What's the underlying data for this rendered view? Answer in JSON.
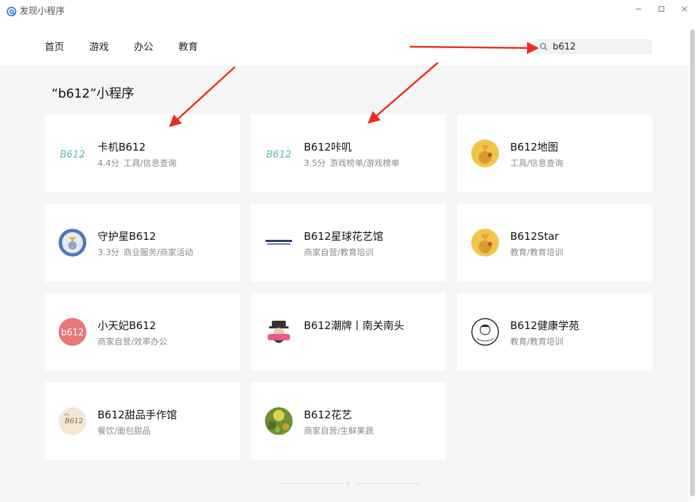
{
  "window": {
    "title": "发现小程序"
  },
  "nav": {
    "tabs": [
      {
        "label": "首页"
      },
      {
        "label": "游戏"
      },
      {
        "label": "办公"
      },
      {
        "label": "教育"
      }
    ],
    "search": {
      "value": "b612",
      "icon": "search-icon"
    }
  },
  "results": {
    "title": "“b612”小程序",
    "items": [
      {
        "name": "卡机B612",
        "rating": "4.4分",
        "category": "工具/信息查询",
        "icon": "b612-logo-teal"
      },
      {
        "name": "B612咔叽",
        "rating": "3.5分",
        "category": "游戏榜单/游戏榜单",
        "icon": "b612-logo-teal"
      },
      {
        "name": "B612地图",
        "rating": "",
        "category": "工具/信息查询",
        "icon": "little-prince-avatar"
      },
      {
        "name": "守护星B612",
        "rating": "3.3分",
        "category": "商业服务/商家活动",
        "icon": "little-prince-badge"
      },
      {
        "name": "B612星球花艺馆",
        "rating": "",
        "category": "商家自营/教育培训",
        "icon": "b612-flora-logo"
      },
      {
        "name": "B612Star",
        "rating": "",
        "category": "教育/教育培训",
        "icon": "little-prince-avatar"
      },
      {
        "name": "小天妃B612",
        "rating": "",
        "category": "商家自营/效率办公",
        "icon": "b612-pink-circle"
      },
      {
        "name": "B612潮牌丨南关南头",
        "rating": "",
        "category": "",
        "icon": "hat-man-logo"
      },
      {
        "name": "B612健康学苑",
        "rating": "",
        "category": "教育/教育培训",
        "icon": "sketch-portrait-logo"
      },
      {
        "name": "B612甜品手作馆",
        "rating": "",
        "category": "餐饮/面包甜品",
        "icon": "dessert-logo"
      },
      {
        "name": "B612花艺",
        "rating": "",
        "category": "商家自营/生鲜果蔬",
        "icon": "flower-photo"
      }
    ]
  },
  "colors": {
    "content_bg": "#f5f5f5",
    "card_bg": "#ffffff",
    "meta_text": "#8a8a8a",
    "accent_teal": "#5fb8b8",
    "arrow_red": "#e8301e"
  }
}
